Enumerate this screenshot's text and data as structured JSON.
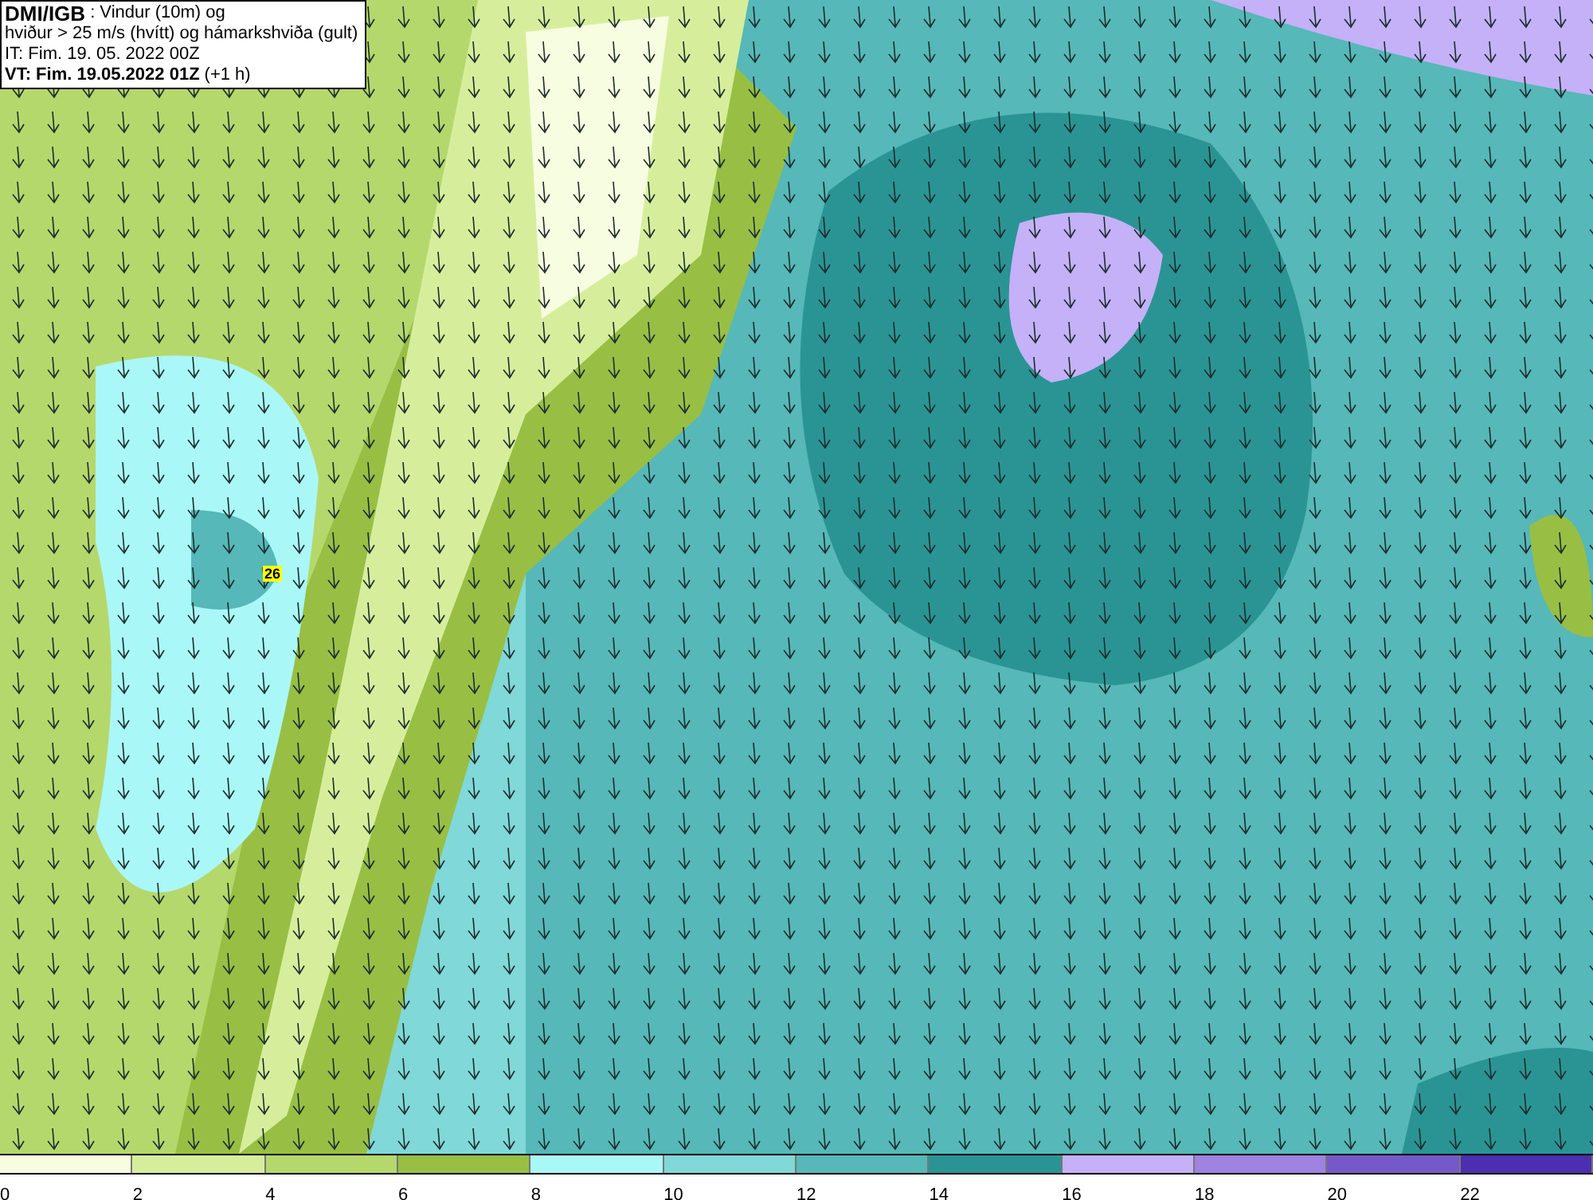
{
  "title_box": {
    "source": "DMI/IGB",
    "description": ": Vindur (10m) og",
    "line_2": "hviður > 25 m/s (hvítt) og hámarkshviða (gult)",
    "issue_time": "IT: Fim. 19. 05. 2022 00Z",
    "valid_time": "VT: Fim. 19.05.2022 01Z",
    "valid_offset": "(+1 h)"
  },
  "map": {
    "gust_label": "26"
  },
  "legend": {
    "swatches": [
      {
        "color": "#f7fde0"
      },
      {
        "color": "#d6ee9c"
      },
      {
        "color": "#b5d86c"
      },
      {
        "color": "#98bf44"
      },
      {
        "color": "#aaf7f7"
      },
      {
        "color": "#80d8d8"
      },
      {
        "color": "#56b8b8"
      },
      {
        "color": "#2a9494"
      },
      {
        "color": "#c4b1f7"
      },
      {
        "color": "#9e83e0"
      },
      {
        "color": "#7559c8"
      },
      {
        "color": "#4c2fb0"
      }
    ],
    "ticks": [
      "0",
      "2",
      "4",
      "6",
      "8",
      "10",
      "12",
      "14",
      "16",
      "18",
      "20",
      "22"
    ]
  }
}
